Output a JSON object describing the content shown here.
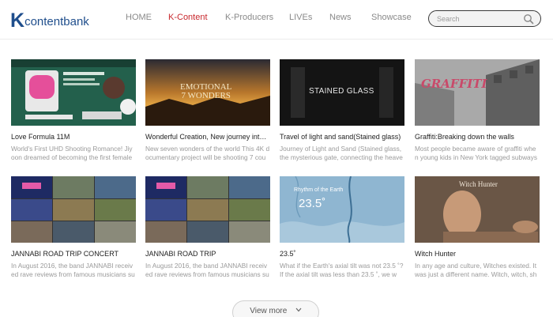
{
  "logo": {
    "k": "K",
    "rest": "contentbank"
  },
  "nav": [
    {
      "label": "HOME"
    },
    {
      "label": "K-Content"
    },
    {
      "label": "K-Producers"
    },
    {
      "label": "LIVEs"
    },
    {
      "label": "News"
    },
    {
      "label": "Showcase"
    }
  ],
  "search": {
    "placeholder": "Search"
  },
  "cards": [
    {
      "title": "Love Formula 11M",
      "desc": "World's First UHD Shooting Romance! Jiyoon dreamed of becoming the first female pl..."
    },
    {
      "title": "Wonderful Creation, New journey into th...",
      "desc": "New seven wonders of the world This 4K documentary project will be shooting 7 coun...",
      "thumb_text": "EMOTIONAL\n7 WONDERS"
    },
    {
      "title": "Travel of light and sand(Stained glass)",
      "desc": "Journey of Light and Sand (Stained glass, the mysterious gate, connecting the heaven...",
      "thumb_text": "STAINED GLASS"
    },
    {
      "title": "Graffiti:Breaking down the walls",
      "desc": "Most people became aware of graffiti when young kids in New York tagged subways in...",
      "thumb_text": "GRAFFITI"
    },
    {
      "title": "JANNABI ROAD TRIP CONCERT",
      "desc": "In August 2016, the band JANNABI received rave reviews from famous musicians such ..."
    },
    {
      "title": "JANNABI ROAD TRIP",
      "desc": "In August 2016, the band JANNABI received rave reviews from famous musicians such ..."
    },
    {
      "title": "23.5˚",
      "desc": "What if the Earth's axial tilt was not 23.5 ˚? If the axial tilt was less than 23.5 ˚, we wo...",
      "thumb_caption": "Rhythm of the Earth",
      "thumb_big": "23.5˚"
    },
    {
      "title": "Witch Hunter",
      "desc": "In any age and culture, Witches existed. It was just a different name. Witch, witch, sha...",
      "thumb_text": "Witch Hunter"
    }
  ],
  "view_more": {
    "label": "View more"
  },
  "colors": {
    "accent": "#c8282d",
    "brand": "#1f4e8c"
  }
}
